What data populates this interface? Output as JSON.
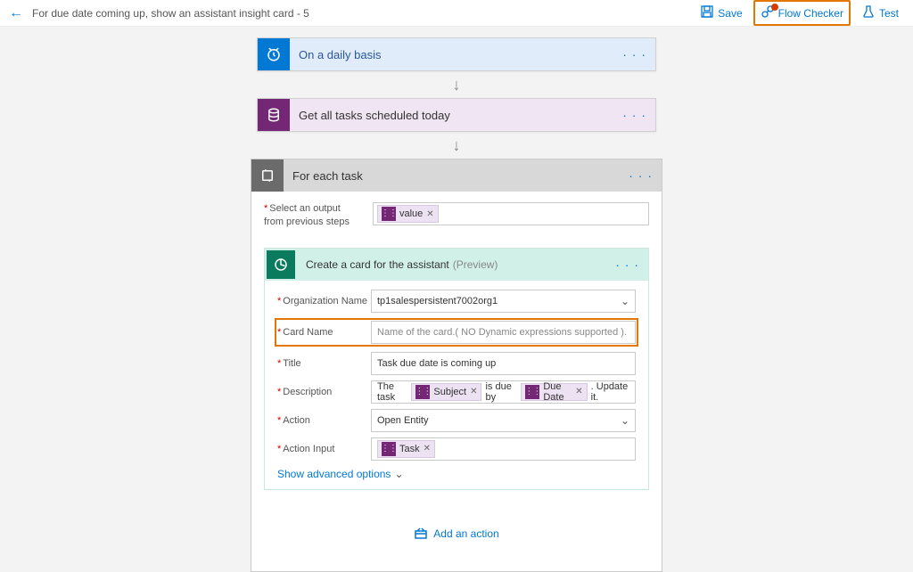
{
  "header": {
    "flow_title": "For due date coming up, show an assistant insight card - 5",
    "save": "Save",
    "flow_checker": "Flow Checker",
    "test": "Test"
  },
  "trigger": {
    "title": "On a daily basis"
  },
  "step1": {
    "title": "Get all tasks scheduled today"
  },
  "foreach": {
    "title": "For each task",
    "select_label": "Select an output from previous steps",
    "value_token": "value"
  },
  "create_card": {
    "title": "Create a card for the assistant",
    "preview": "(Preview)",
    "fields": {
      "org_label": "Organization Name",
      "org_value": "tp1salespersistent7002org1",
      "card_name_label": "Card Name",
      "card_name_placeholder": "Name of the card.( NO Dynamic expressions supported ).",
      "title_label": "Title",
      "title_value": "Task due date is coming up",
      "desc_label": "Description",
      "desc_pre": "The task",
      "desc_token1": "Subject",
      "desc_mid": "is due by",
      "desc_token2": "Due Date",
      "desc_post": ". Update it.",
      "action_label": "Action",
      "action_value": "Open Entity",
      "action_input_label": "Action Input",
      "action_input_token": "Task"
    },
    "show_advanced": "Show advanced options"
  },
  "add_action": "Add an action"
}
